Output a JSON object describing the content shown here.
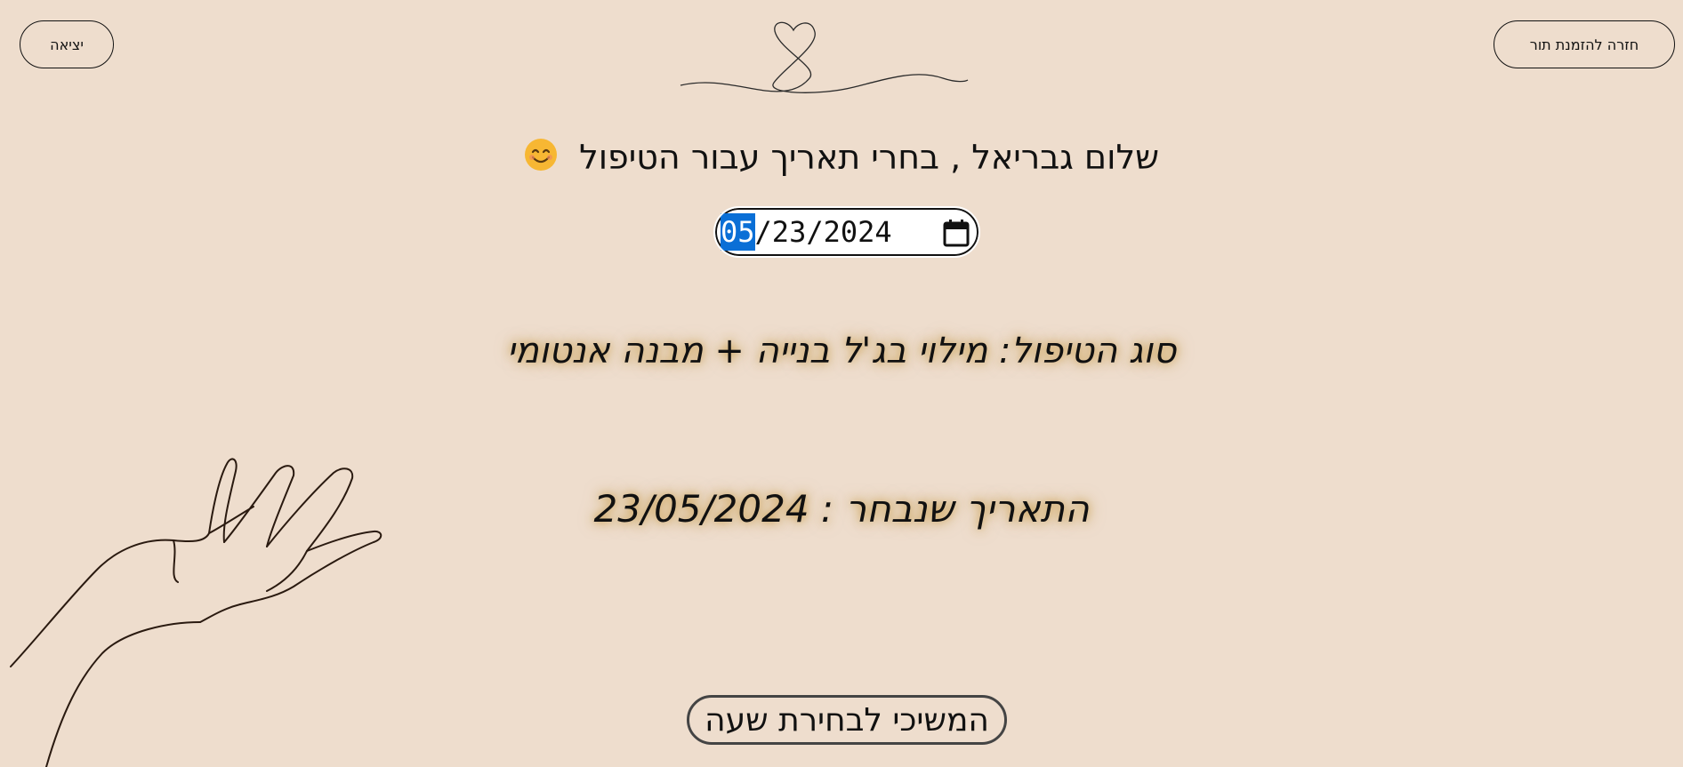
{
  "header": {
    "logout_label": "יציאה",
    "back_label": "חזרה להזמנת תור"
  },
  "greeting": {
    "text": "שלום גבריאל , בחרי תאריך עבור הטיפול",
    "emoji_icon": "smiling-face-icon"
  },
  "date_picker": {
    "month": "05",
    "rest": "/23/2024",
    "value": "05/23/2024",
    "icon": "calendar-icon"
  },
  "treatment": {
    "text": "סוג הטיפול: מילוי בג'ל בנייה + מבנה אנטומי"
  },
  "selected_date": {
    "text": "התאריך שנבחר : 23/05/2024"
  },
  "continue_label": "המשיכי לבחירת שעה",
  "colors": {
    "background": "#eeddcd",
    "glow": "#be8c28",
    "selection": "#0a6fd6"
  }
}
